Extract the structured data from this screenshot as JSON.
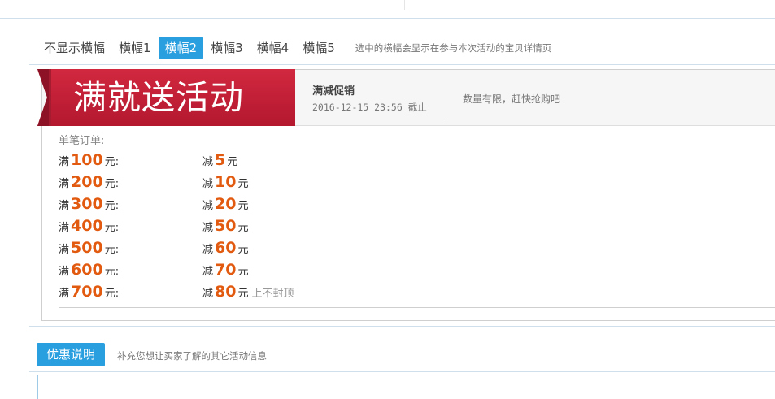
{
  "tabs": {
    "items": [
      "不显示横幅",
      "横幅1",
      "横幅2",
      "横幅3",
      "横幅4",
      "横幅5"
    ],
    "active_index": 2,
    "hint": "选中的横幅会显示在参与本次活动的宝贝详情页"
  },
  "banner": {
    "ribbon_text": "满就送活动",
    "promo_title": "满减促销",
    "promo_date": "2016-12-15 23:56 截止",
    "promo_note": "数量有限，赶快抢购吧",
    "colors": {
      "ribbon": "#c21f3a",
      "ribbon_dark": "#8e1226",
      "highlight": "#e25a0f",
      "accent": "#2a9fe0"
    }
  },
  "rules": {
    "title": "单笔订单:",
    "full_prefix": "满",
    "full_suffix": "元:",
    "minus_prefix": "减",
    "minus_suffix": "元",
    "items": [
      {
        "threshold": "100",
        "discount": "5",
        "note": ""
      },
      {
        "threshold": "200",
        "discount": "10",
        "note": ""
      },
      {
        "threshold": "300",
        "discount": "20",
        "note": ""
      },
      {
        "threshold": "400",
        "discount": "50",
        "note": ""
      },
      {
        "threshold": "500",
        "discount": "60",
        "note": ""
      },
      {
        "threshold": "600",
        "discount": "70",
        "note": ""
      },
      {
        "threshold": "700",
        "discount": "80",
        "note": "上不封顶"
      }
    ]
  },
  "description": {
    "button_label": "优惠说明",
    "hint": "补充您想让买家了解的其它活动信息",
    "textarea_value": ""
  }
}
